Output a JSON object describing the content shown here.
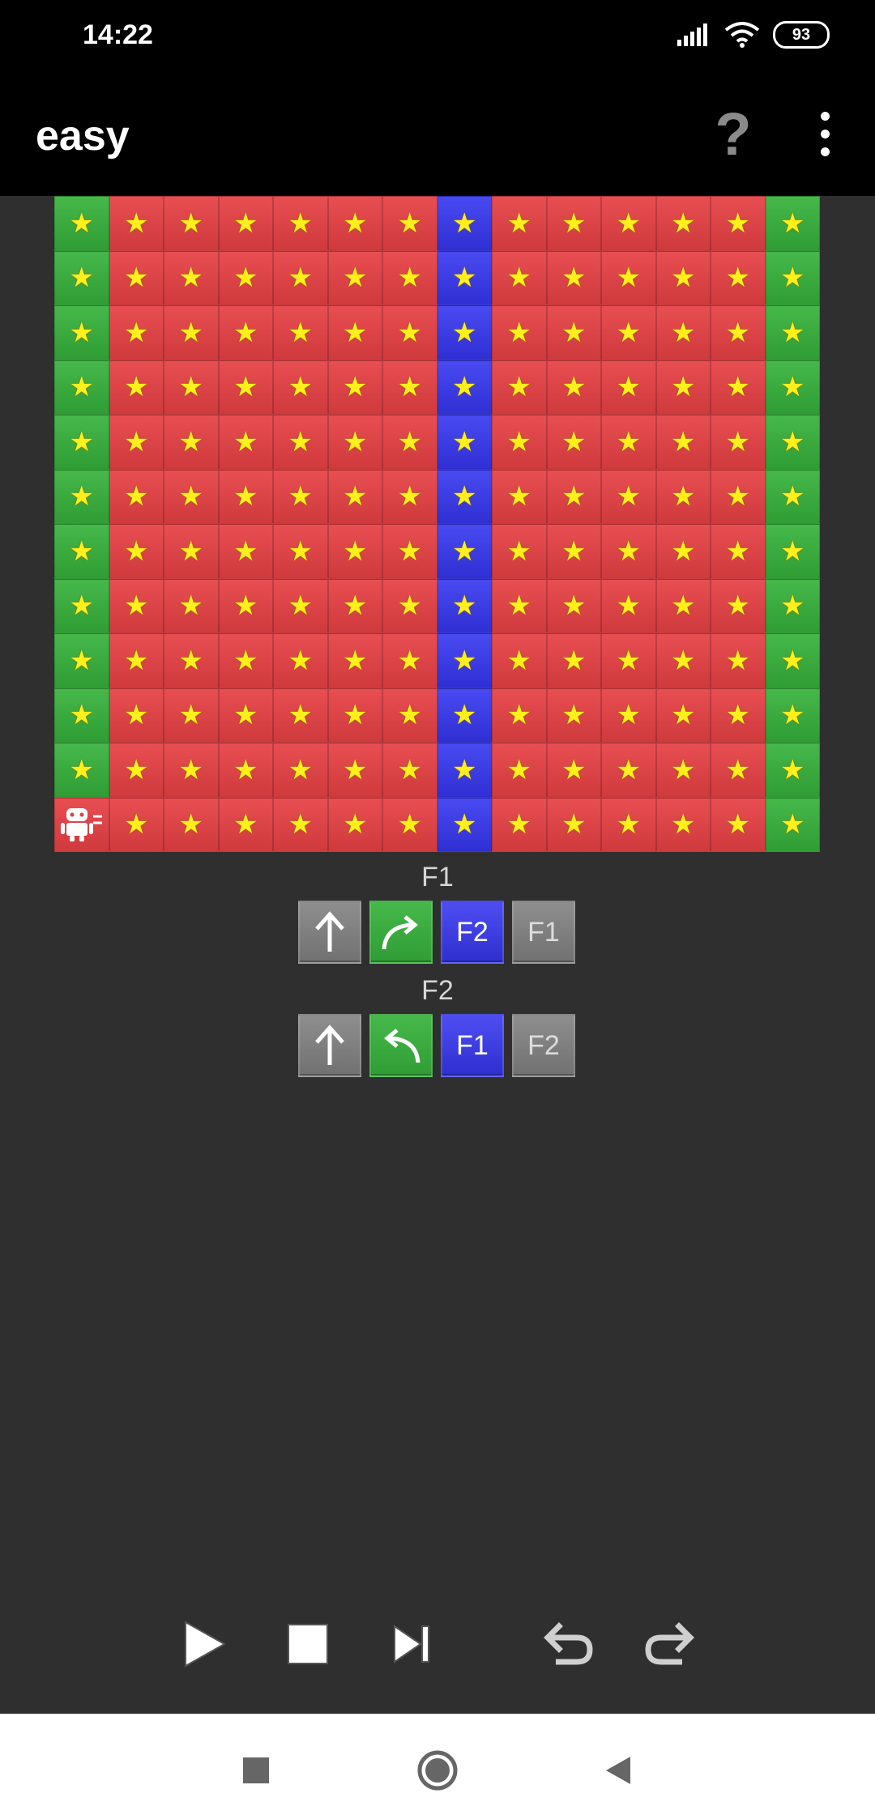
{
  "status_bar": {
    "time": "14:22",
    "battery": "93",
    "icons": [
      "signal-icon",
      "wifi-icon",
      "battery-icon"
    ]
  },
  "app_bar": {
    "title": "easy",
    "help_label": "?",
    "menu_icon": "more-vert-icon"
  },
  "board": {
    "rows": 12,
    "cols": 14,
    "column_colors": [
      "green",
      "red",
      "red",
      "red",
      "red",
      "red",
      "red",
      "blue",
      "red",
      "red",
      "red",
      "red",
      "red",
      "green"
    ],
    "cell_symbol": "★",
    "robot": {
      "row": 11,
      "col": 0,
      "icon": "android-robot-icon"
    },
    "robot_cell_color": "red"
  },
  "functions": [
    {
      "label": "F1",
      "tiles": [
        {
          "type": "forward",
          "color": "gray",
          "icon": "arrow-up-icon",
          "text": ""
        },
        {
          "type": "turn-right",
          "color": "green",
          "icon": "turn-right-icon",
          "text": ""
        },
        {
          "type": "call",
          "color": "blue",
          "icon": "",
          "text": "F2"
        },
        {
          "type": "call",
          "color": "gray",
          "icon": "",
          "text": "F1"
        }
      ]
    },
    {
      "label": "F2",
      "tiles": [
        {
          "type": "forward",
          "color": "gray",
          "icon": "arrow-up-icon",
          "text": ""
        },
        {
          "type": "turn-left",
          "color": "green",
          "icon": "turn-left-icon",
          "text": ""
        },
        {
          "type": "call",
          "color": "blue",
          "icon": "",
          "text": "F1"
        },
        {
          "type": "call",
          "color": "gray",
          "icon": "",
          "text": "F2"
        }
      ]
    }
  ],
  "controls": [
    "play-icon",
    "stop-icon",
    "step-icon",
    "undo-icon",
    "redo-icon"
  ],
  "nav": [
    "recents-icon",
    "home-icon",
    "back-icon"
  ],
  "colors": {
    "red": "#d84245",
    "green": "#3aa93f",
    "blue": "#3a3ae0",
    "gray": "#7f7f7f",
    "star": "#ffef1a",
    "background": "#2f2f2f"
  }
}
